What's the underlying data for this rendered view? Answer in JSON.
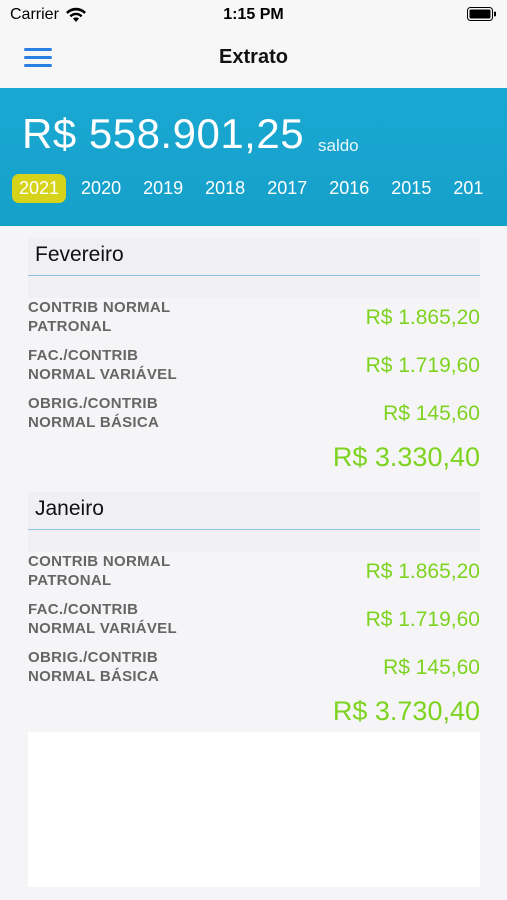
{
  "status_bar": {
    "carrier": "Carrier",
    "time": "1:15 PM"
  },
  "nav": {
    "title": "Extrato"
  },
  "balance": {
    "amount": "R$ 558.901,25",
    "label": "saldo"
  },
  "years": [
    "2021",
    "2020",
    "2019",
    "2018",
    "2017",
    "2016",
    "2015",
    "201"
  ],
  "months": [
    {
      "name": "Fevereiro",
      "entries": [
        {
          "label_line1": "CONTRIB NORMAL",
          "label_line2": "PATRONAL",
          "value": "R$ 1.865,20"
        },
        {
          "label_line1": "FAC./CONTRIB",
          "label_line2": "NORMAL VARIÁVEL",
          "value": "R$ 1.719,60"
        },
        {
          "label_line1": "OBRIG./CONTRIB",
          "label_line2": "NORMAL BÁSICA",
          "value": "R$ 145,60"
        }
      ],
      "total": "R$ 3.330,40"
    },
    {
      "name": "Janeiro",
      "entries": [
        {
          "label_line1": "CONTRIB NORMAL",
          "label_line2": "PATRONAL",
          "value": "R$ 1.865,20"
        },
        {
          "label_line1": "FAC./CONTRIB",
          "label_line2": "NORMAL VARIÁVEL",
          "value": "R$ 1.719,60"
        },
        {
          "label_line1": "OBRIG./CONTRIB",
          "label_line2": "NORMAL BÁSICA",
          "value": "R$ 145,60"
        }
      ],
      "total": "R$ 3.730,40"
    }
  ],
  "colors": {
    "header_bg": "#15a0c9",
    "active_year": "#d6d31a",
    "value_green": "#7ed321",
    "menu_blue": "#2a7de1"
  },
  "icons": [
    "wifi-icon",
    "battery-icon",
    "menu-icon"
  ]
}
